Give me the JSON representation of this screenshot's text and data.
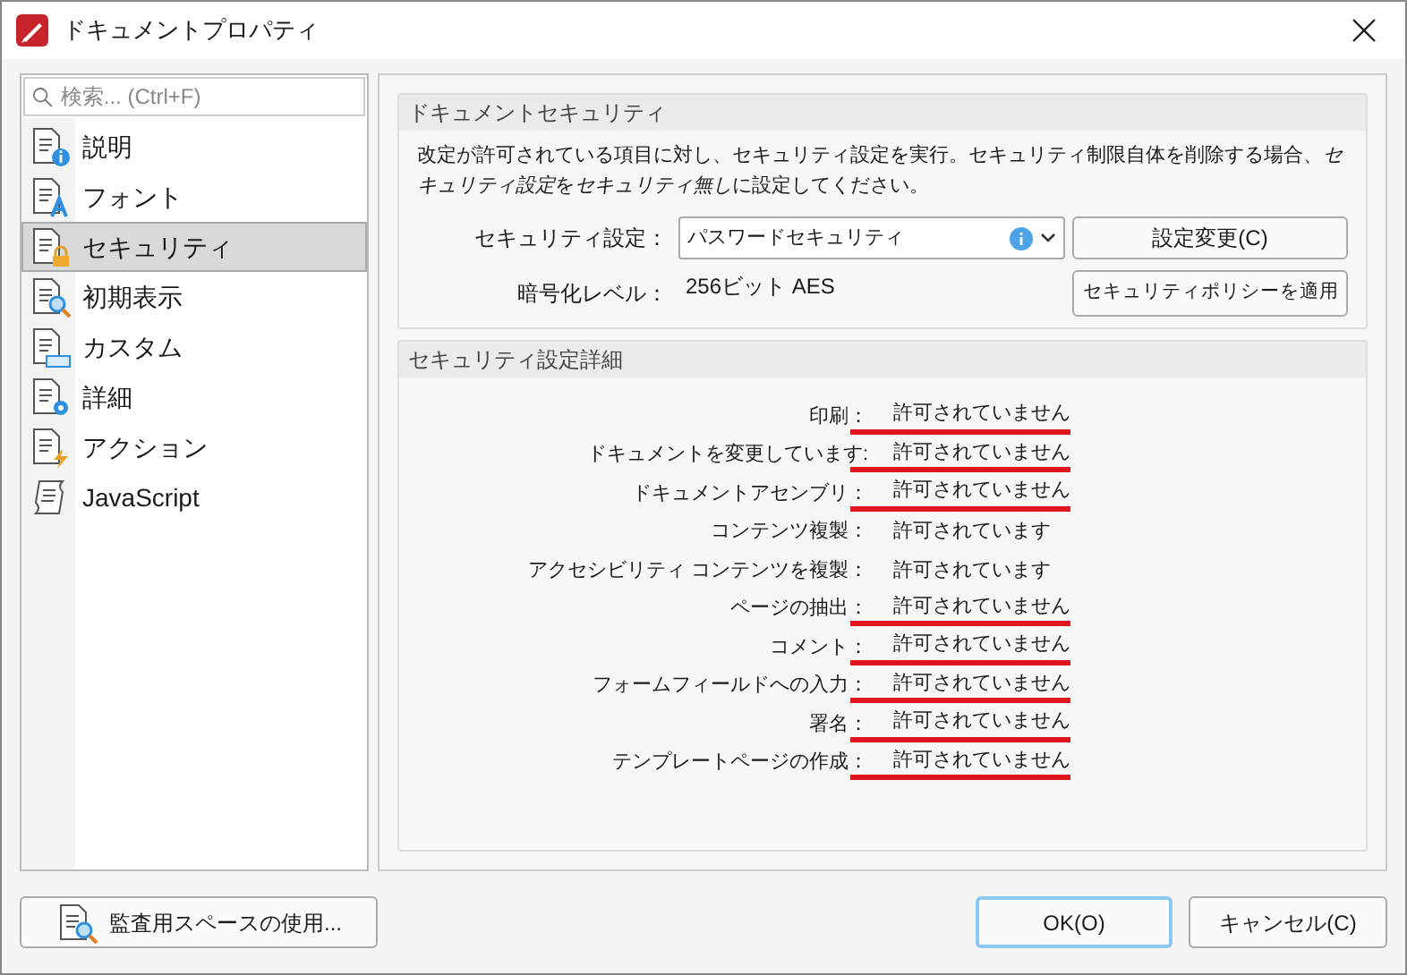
{
  "window": {
    "title": "ドキュメントプロパティ"
  },
  "search": {
    "placeholder": "検索... (Ctrl+F)"
  },
  "sidebar": {
    "items": [
      {
        "label": "説明",
        "selected": false
      },
      {
        "label": "フォント",
        "selected": false
      },
      {
        "label": "セキュリティ",
        "selected": true
      },
      {
        "label": "初期表示",
        "selected": false
      },
      {
        "label": "カスタム",
        "selected": false
      },
      {
        "label": "詳細",
        "selected": false
      },
      {
        "label": "アクション",
        "selected": false
      },
      {
        "label": "JavaScript",
        "selected": false
      }
    ]
  },
  "security": {
    "title": "ドキュメントセキュリティ",
    "description": [
      {
        "text": "改定が許可されている項目に対し、セキュリティ設定を実行。セキュリティ制限自体を削除する場合、",
        "italic": false
      },
      {
        "text": "セキュリティ設定",
        "italic": true
      },
      {
        "text": "を",
        "italic": false
      },
      {
        "text": "セキュリティ無し",
        "italic": true
      },
      {
        "text": "に設定してください。",
        "italic": false
      }
    ],
    "setting_label": "セキュリティ設定：",
    "setting_value": "パスワードセキュリティ",
    "change_button": "設定変更(C)",
    "level_label": "暗号化レベル：",
    "level_value": "256ビット AES",
    "policy_button": "セキュリティポリシーを適用"
  },
  "details": {
    "title": "セキュリティ設定詳細",
    "rows": [
      {
        "label": "印刷：",
        "value": "許可されていません",
        "allowed": false
      },
      {
        "label": "ドキュメントを変更しています:",
        "value": "許可されていません",
        "allowed": false
      },
      {
        "label": "ドキュメントアセンブリ：",
        "value": "許可されていません",
        "allowed": false
      },
      {
        "label": "コンテンツ複製：",
        "value": "許可されています",
        "allowed": true
      },
      {
        "label": "アクセシビリティ コンテンツを複製：",
        "value": "許可されています",
        "allowed": true
      },
      {
        "label": "ページの抽出：",
        "value": "許可されていません",
        "allowed": false
      },
      {
        "label": "コメント：",
        "value": "許可されていません",
        "allowed": false
      },
      {
        "label": "フォームフィールドへの入力：",
        "value": "許可されていません",
        "allowed": false
      },
      {
        "label": "署名：",
        "value": "許可されていません",
        "allowed": false
      },
      {
        "label": "テンプレートページの作成：",
        "value": "許可されていません",
        "allowed": false
      }
    ]
  },
  "buttons": {
    "audit": "監査用スペースの使用...",
    "ok": "OK(O)",
    "cancel": "キャンセル(C)"
  }
}
